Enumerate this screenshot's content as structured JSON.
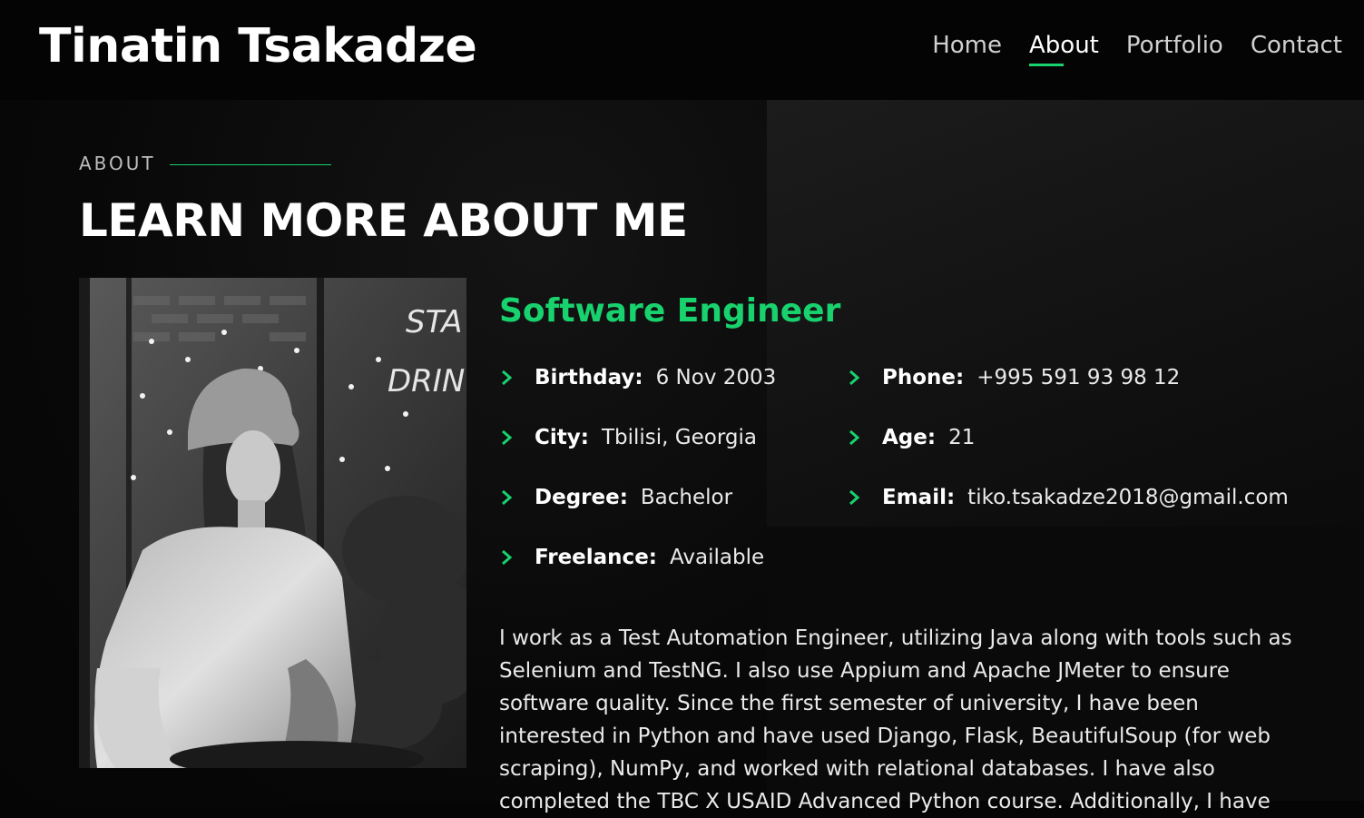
{
  "header": {
    "logo": "Tinatin Tsakadze",
    "nav": [
      {
        "label": "Home",
        "active": false
      },
      {
        "label": "About",
        "active": true
      },
      {
        "label": "Portfolio",
        "active": false
      },
      {
        "label": "Contact",
        "active": false
      }
    ]
  },
  "about": {
    "eyebrow": "ABOUT",
    "title": "LEARN MORE ABOUT ME",
    "role": "Software Engineer",
    "info": {
      "birthday": {
        "label": "Birthday:",
        "value": "6 Nov 2003"
      },
      "phone": {
        "label": "Phone:",
        "value": "+995 591 93 98 12"
      },
      "city": {
        "label": "City:",
        "value": "Tbilisi, Georgia"
      },
      "age": {
        "label": "Age:",
        "value": "21"
      },
      "degree": {
        "label": "Degree:",
        "value": "Bachelor"
      },
      "email": {
        "label": "Email:",
        "value": "tiko.tsakadze2018@gmail.com"
      },
      "freelance": {
        "label": "Freelance:",
        "value": "Available"
      }
    },
    "bio": "I work as a Test Automation Engineer, utilizing Java along with tools such as Selenium and TestNG. I also use Appium and Apache JMeter to ensure software quality. Since the first semester of university, I have been interested in Python and have used Django, Flask, BeautifulSoup (for web scraping), NumPy, and worked with relational databases. I have also completed the TBC X USAID Advanced Python course. Additionally, I have"
  },
  "colors": {
    "accent": "#18d26e",
    "background": "#050505",
    "text": "#ffffff"
  },
  "icons": {
    "info_bullet": "chevron-right-icon"
  }
}
